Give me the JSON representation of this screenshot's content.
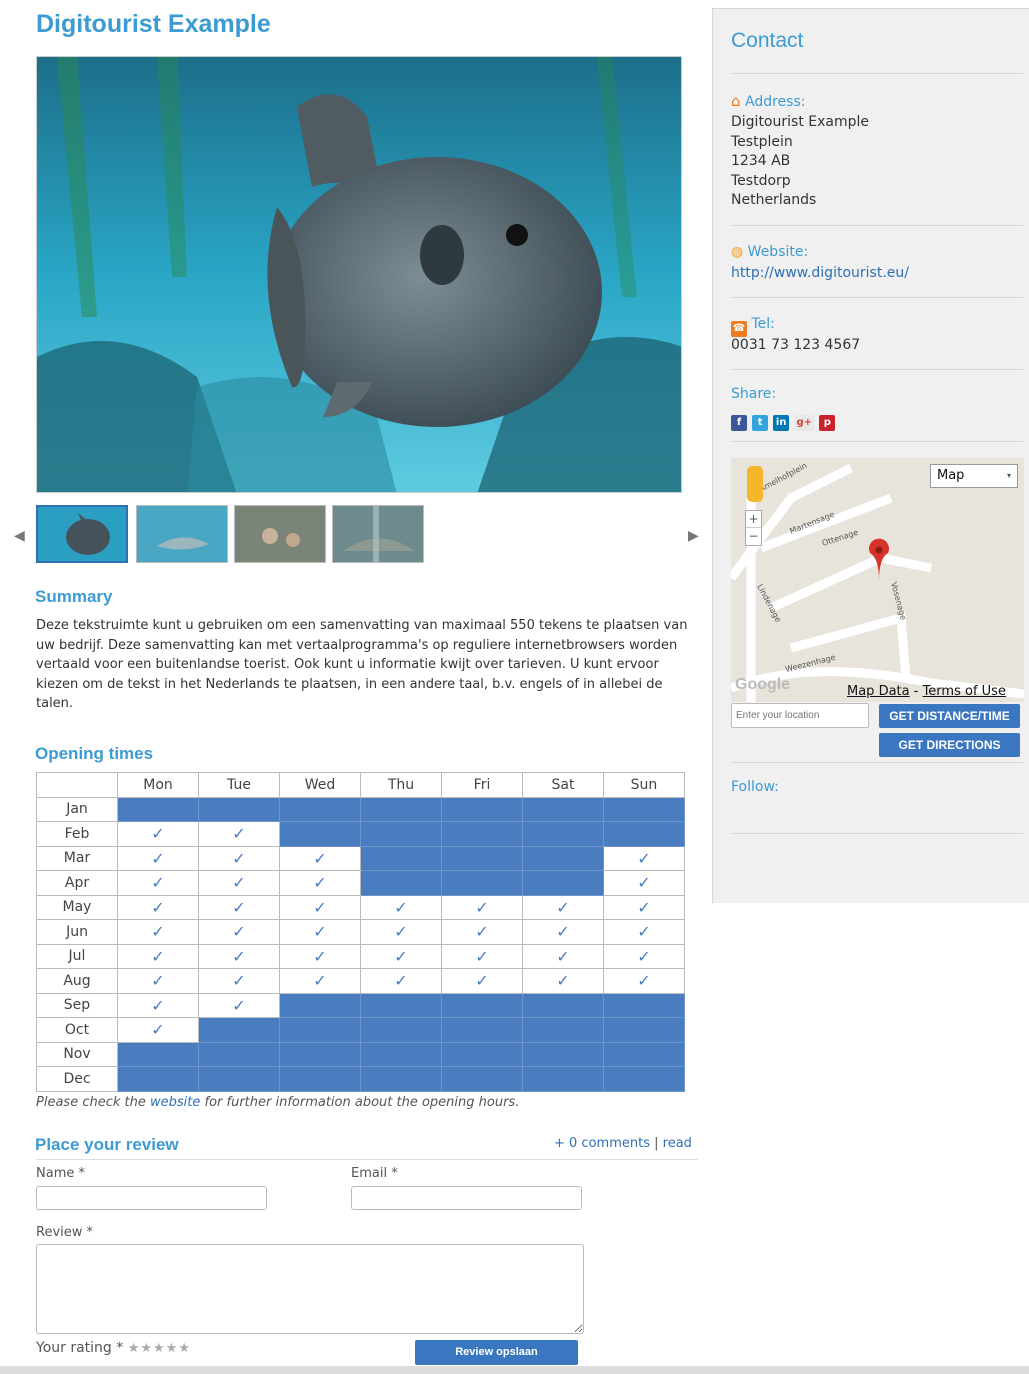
{
  "page": {
    "title": "Digitourist Example"
  },
  "gallery": {
    "thumb_count": 4,
    "prev_label": "◀",
    "next_label": "▶"
  },
  "summary": {
    "heading": "Summary",
    "text": "Deze tekstruimte kunt u gebruiken om een samenvatting van maximaal 550 tekens te plaatsen van uw bedrijf. Deze samenvatting kan met vertaalprogramma's op reguliere internetbrowsers worden vertaald voor een buitenlandse toerist. Ook kunt u informatie kwijt over tarieven. U kunt ervoor kiezen om de tekst in het Nederlands te plaatsen, in een andere taal, b.v. engels of in allebei de talen."
  },
  "opening": {
    "heading": "Opening times",
    "days": [
      "Mon",
      "Tue",
      "Wed",
      "Thu",
      "Fri",
      "Sat",
      "Sun"
    ],
    "rows": [
      {
        "month": "Jan",
        "open": [
          0,
          0,
          0,
          0,
          0,
          0,
          0
        ]
      },
      {
        "month": "Feb",
        "open": [
          1,
          1,
          0,
          0,
          0,
          0,
          0
        ]
      },
      {
        "month": "Mar",
        "open": [
          1,
          1,
          1,
          0,
          0,
          0,
          1
        ]
      },
      {
        "month": "Apr",
        "open": [
          1,
          1,
          1,
          0,
          0,
          0,
          1
        ]
      },
      {
        "month": "May",
        "open": [
          1,
          1,
          1,
          1,
          1,
          1,
          1
        ]
      },
      {
        "month": "Jun",
        "open": [
          1,
          1,
          1,
          1,
          1,
          1,
          1
        ]
      },
      {
        "month": "Jul",
        "open": [
          1,
          1,
          1,
          1,
          1,
          1,
          1
        ]
      },
      {
        "month": "Aug",
        "open": [
          1,
          1,
          1,
          1,
          1,
          1,
          1
        ]
      },
      {
        "month": "Sep",
        "open": [
          1,
          1,
          0,
          0,
          0,
          0,
          0
        ]
      },
      {
        "month": "Oct",
        "open": [
          1,
          0,
          0,
          0,
          0,
          0,
          0
        ]
      },
      {
        "month": "Nov",
        "open": [
          0,
          0,
          0,
          0,
          0,
          0,
          0
        ]
      },
      {
        "month": "Dec",
        "open": [
          0,
          0,
          0,
          0,
          0,
          0,
          0
        ]
      }
    ],
    "check_glyph": "✓",
    "note_before": "Please check the ",
    "note_link": "website",
    "note_after": " for further information about the opening hours."
  },
  "review": {
    "heading": "Place your review",
    "comments_label": "+ 0 comments",
    "separator": "|",
    "read_label": "read",
    "name_label": "Name *",
    "email_label": "Email *",
    "review_label": "Review *",
    "rating_label": "Your rating *",
    "stars": "★★★★★",
    "submit_label": "Review opslaan"
  },
  "contact": {
    "heading": "Contact",
    "address_label": "Address:",
    "address_lines": [
      "Digitourist Example",
      "Testplein",
      "1234 AB",
      "Testdorp",
      "Netherlands"
    ],
    "website_label": "Website:",
    "website_url": "http://www.digitourist.eu/",
    "tel_label": "Tel:",
    "tel_value": "0031 73 123 4567",
    "share_label": "Share:",
    "follow_label": "Follow:"
  },
  "map": {
    "type_select": "Map",
    "zoom_in": "+",
    "zoom_out": "−",
    "google_label": "Google",
    "map_data_label": "Map Data",
    "dash": " - ",
    "terms_label": "Terms of Use",
    "location_placeholder": "Enter your location",
    "distance_button": "GET DISTANCE/TIME",
    "directions_button": "GET DIRECTIONS",
    "streets": [
      "Amelhofplein",
      "Martensage",
      "Ottenage",
      "Lindenage",
      "Weezenhage",
      "Vosenage"
    ]
  },
  "colors": {
    "accent": "#3d9bd3",
    "closed_cell": "#4a7cc0",
    "button": "#3b77c0",
    "sidebar_bg": "#f0f0f0"
  }
}
